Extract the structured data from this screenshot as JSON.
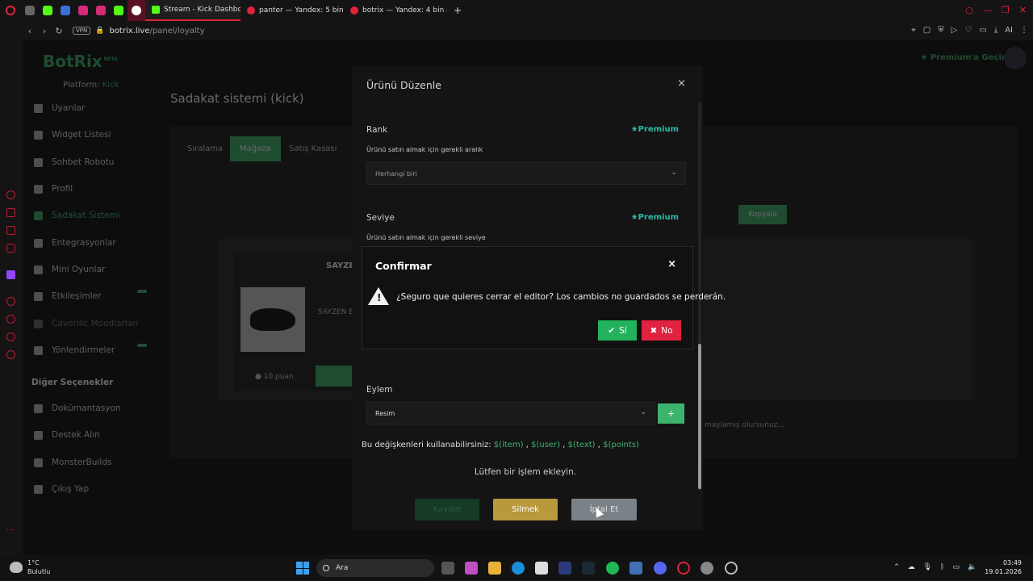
{
  "browser": {
    "tabs": [
      {
        "label": "Stream - Kick Dashbo",
        "active": true
      },
      {
        "label": "panter — Yandex: 5 bin so",
        "active": false
      },
      {
        "label": "botrix — Yandex: 4 bin son",
        "active": false
      }
    ],
    "new_tab": "+",
    "vpn_label": "VPN",
    "url_domain": "botrix.live",
    "url_path": "/panel/loyalty",
    "ai_label": "AI"
  },
  "page": {
    "logo": "BotRix",
    "logo_badge": "BETA",
    "platform_label": "Platform:",
    "platform_value": "Kick",
    "premium_link": "Premium'a Geçin",
    "title": "Sadakat sistemi (kick)",
    "menu": [
      {
        "label": "Uyarılar"
      },
      {
        "label": "Widget Listesi"
      },
      {
        "label": "Sohbet Robotu"
      },
      {
        "label": "Profil"
      },
      {
        "label": "Sadakat Sistemi"
      },
      {
        "label": "Entegrasyonlar"
      },
      {
        "label": "Mini Oyunlar"
      },
      {
        "label": "Etkileşimler"
      },
      {
        "label": "Caveriilc Moodlarlari"
      },
      {
        "label": "Yönlendirmeler"
      }
    ],
    "other_section": "Diğer Seçenekler",
    "other_menu": [
      {
        "label": "Dokümantasyon"
      },
      {
        "label": "Destek Alın"
      },
      {
        "label": "MonsterBuilds"
      },
      {
        "label": "Çıkış Yap"
      }
    ],
    "tabs": [
      "Sıralama",
      "Mağaza",
      "Satış Kasası"
    ],
    "copy_button": "Kopyala",
    "product_title": "SAYZEN",
    "product_subtitle": "SAYZEN E",
    "product_price": "10 puan",
    "faded_text": "maylamış olursunuz..."
  },
  "editor": {
    "title": "Ürünü Düzenle",
    "close": "×",
    "rank_label": "Rank",
    "rank_help": "Ürünü satın almak için gerekli aralık",
    "rank_value": "Herhangi biri",
    "premium": "Premium",
    "level_label": "Seviye",
    "level_help": "Ürünü satın almak için gerekli seviye",
    "action_label": "Eylem",
    "action_value": "Resim",
    "add_button": "+",
    "vars_prefix": "Bu değişkenleri kullanabilirsiniz:",
    "vars": [
      "$(item)",
      "$(user)",
      "$(text)",
      "$(points)"
    ],
    "empty_msg": "Lütfen bir işlem ekleyin.",
    "save_button": "Kaydet",
    "delete_button": "Silmek",
    "cancel_button": "İptal Et"
  },
  "confirm": {
    "title": "Confirmar",
    "close": "×",
    "message": "¿Seguro que quieres cerrar el editor? Los cambios no guardados se perderán.",
    "yes_label": "Sí",
    "no_label": "No"
  },
  "taskbar": {
    "temperature": "1°C",
    "weather": "Bulutlu",
    "search_placeholder": "Ara",
    "time": "03:49",
    "date": "19.01.2026"
  },
  "colors": {
    "accent_green": "#3db46d",
    "confirm_yes": "#21b25b",
    "confirm_no": "#e0213f",
    "delete_button": "#b89a3d",
    "premium_teal": "#2eb8a7"
  }
}
